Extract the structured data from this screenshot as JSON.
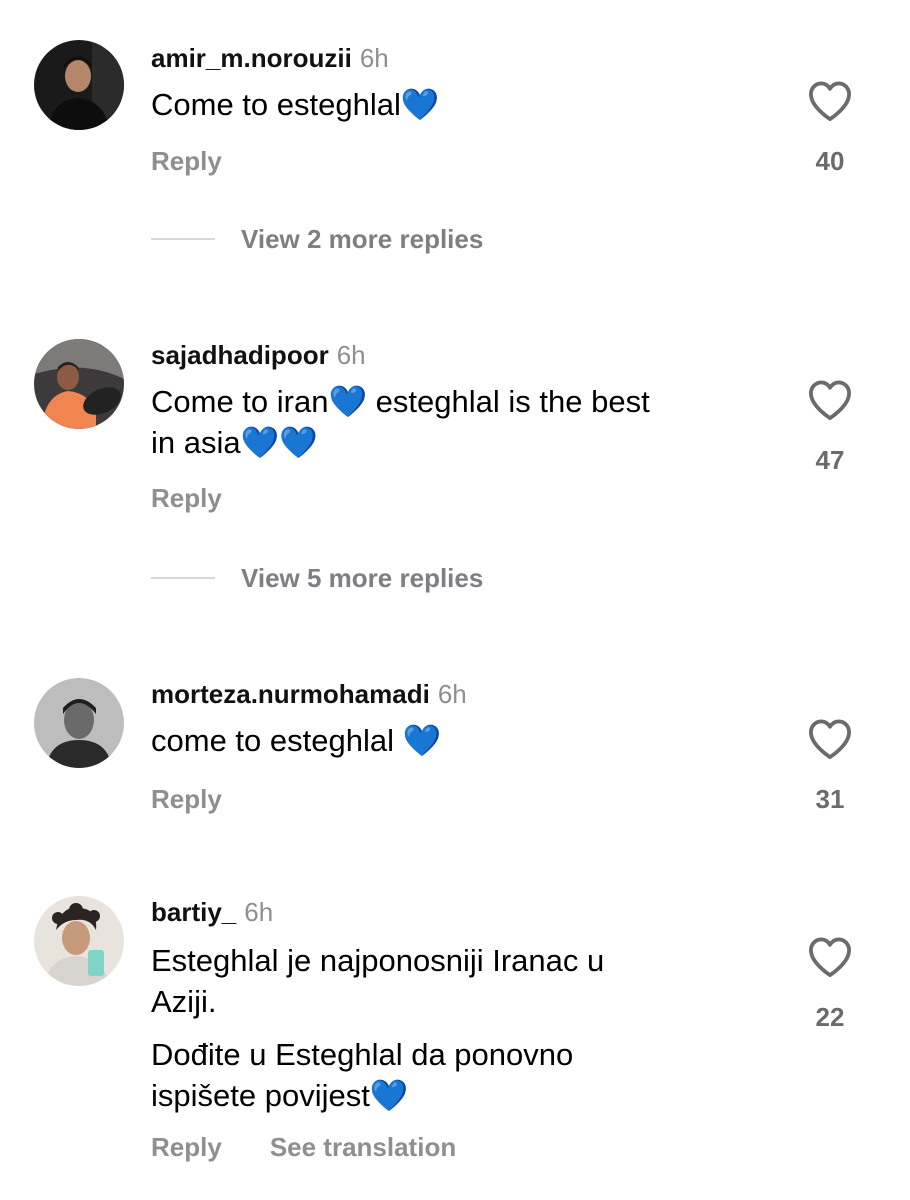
{
  "comments": [
    {
      "username": "amir_m.norouzii",
      "time": "6h",
      "lines": [
        "Come to esteghlal💙"
      ],
      "reply_label": "Reply",
      "likes": "40",
      "view_replies": "View 2 more replies",
      "avatar_icon": "person-photo"
    },
    {
      "username": "sajadhadipoor",
      "time": "6h",
      "lines": [
        "Come to iran💙 esteghlal is the best",
        "in asia💙💙"
      ],
      "reply_label": "Reply",
      "likes": "47",
      "view_replies": "View 5 more replies",
      "avatar_icon": "person-driving-photo"
    },
    {
      "username": "morteza.nurmohamadi",
      "time": "6h",
      "lines": [
        "come to esteghlal 💙"
      ],
      "reply_label": "Reply",
      "likes": "31",
      "avatar_icon": "person-bw-photo"
    },
    {
      "username": "bartiy_",
      "time": "6h",
      "paragraphs": [
        [
          "Esteghlal je najponosniji Iranac u",
          "Aziji."
        ],
        [
          "Dođite u Esteghlal da ponovno",
          "ispišete povijest💙"
        ]
      ],
      "reply_label": "Reply",
      "translate_label": "See translation",
      "likes": "22",
      "avatar_icon": "person-selfie-photo"
    }
  ],
  "colors": {
    "heart_emoji": "#1f6cff",
    "secondary_text": "#8e8e93",
    "like_count": "#6b6b6b"
  },
  "icons": {
    "like": "heart-outline-icon"
  }
}
